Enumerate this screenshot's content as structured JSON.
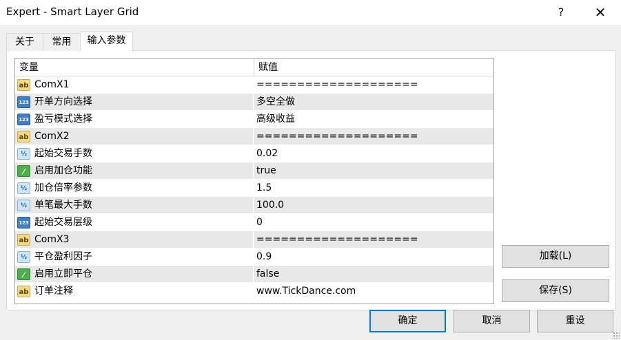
{
  "window": {
    "title": "Expert - Smart Layer Grid",
    "help_glyph": "?",
    "close_glyph": "✕"
  },
  "tabs": [
    {
      "label": "关于",
      "active": false
    },
    {
      "label": "常用",
      "active": false
    },
    {
      "label": "输入参数",
      "active": true
    }
  ],
  "grid": {
    "headers": {
      "variable": "变量",
      "value": "赋值"
    },
    "rows": [
      {
        "icon": "string-icon",
        "glyph": "ab",
        "name": "ComX1",
        "value": "===================="
      },
      {
        "icon": "integer-icon",
        "glyph": "123",
        "name": "开单方向选择",
        "value": "多空全做"
      },
      {
        "icon": "integer-icon",
        "glyph": "123",
        "name": "盈亏模式选择",
        "value": "高级收益"
      },
      {
        "icon": "string-icon",
        "glyph": "ab",
        "name": "ComX2",
        "value": "===================="
      },
      {
        "icon": "double-icon",
        "glyph": "½",
        "name": "起始交易手数",
        "value": "0.02"
      },
      {
        "icon": "bool-icon",
        "glyph": "⁄",
        "name": "启用加仓功能",
        "value": "true"
      },
      {
        "icon": "double-icon",
        "glyph": "½",
        "name": "加仓倍率参数",
        "value": "1.5"
      },
      {
        "icon": "double-icon",
        "glyph": "½",
        "name": "单笔最大手数",
        "value": "100.0"
      },
      {
        "icon": "integer-icon",
        "glyph": "123",
        "name": "起始交易层级",
        "value": "0"
      },
      {
        "icon": "string-icon",
        "glyph": "ab",
        "name": "ComX3",
        "value": "===================="
      },
      {
        "icon": "double-icon",
        "glyph": "½",
        "name": "平仓盈利因子",
        "value": "0.9"
      },
      {
        "icon": "bool-icon",
        "glyph": "⁄",
        "name": "启用立即平仓",
        "value": "false"
      },
      {
        "icon": "string-icon",
        "glyph": "ab",
        "name": "订单注释",
        "value": "www.TickDance.com"
      }
    ]
  },
  "side_buttons": {
    "load": "加载(L)",
    "save": "保存(S)"
  },
  "bottom_buttons": {
    "ok": "确定",
    "cancel": "取消",
    "reset": "重设"
  },
  "colors": {
    "selected_border": "#0078d7",
    "row_alt": "#e8e8e8"
  }
}
